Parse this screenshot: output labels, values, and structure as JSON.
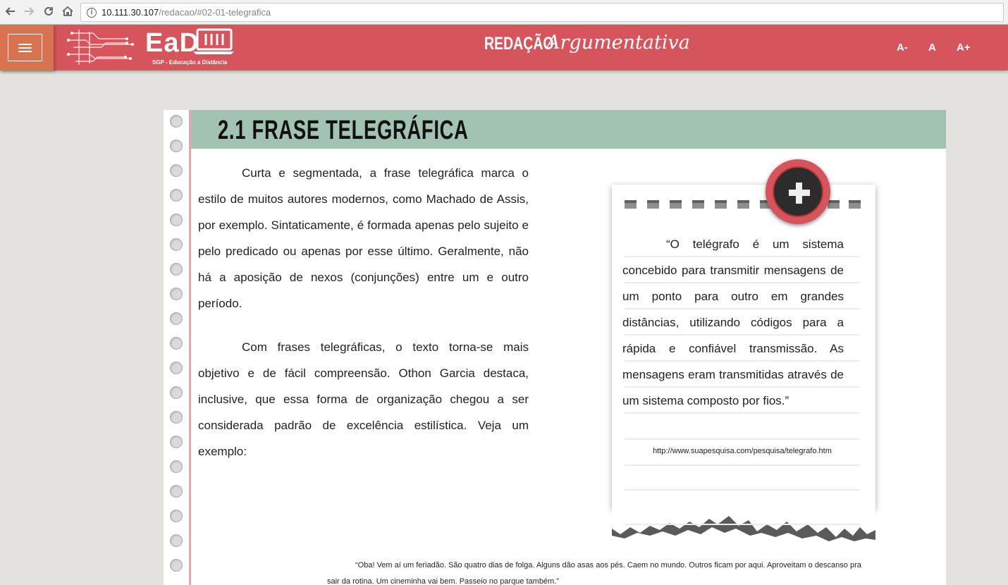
{
  "browser": {
    "url_host": "10.111.30.107",
    "url_path": "/redacao/#02-01-telegrafica"
  },
  "header": {
    "logo_text": "EaD",
    "logo_subtitle": "SGP - Educação a Distância",
    "title_part1": "REDAÇÃO",
    "title_part2": "Argumentativa",
    "font_smaller": "A-",
    "font_normal": "A",
    "font_larger": "A+"
  },
  "section": {
    "title": "2.1 FRASE TELEGRÁFICA"
  },
  "body": {
    "paragraph1": "Curta e segmentada, a frase telegráfica marca o estilo de muitos autores modernos, como Machado de Assis, por exemplo. Sintaticamente, é formada apenas pelo sujeito e pelo predicado ou apenas por esse último. Geralmente, não há a aposição de nexos (conjunções) entre um e outro período.",
    "paragraph2": "Com frases telegráficas, o texto torna-se mais objetivo e de fácil compreensão. Othon Garcia destaca, inclusive, que essa forma de organização chegou a ser considerada padrão de excelência estilística. Veja um exemplo:"
  },
  "note": {
    "quote": "“O telégrafo é um sistema concebido para transmitir mensagens de um ponto para outro em grandes distâncias, utilizando códigos para a rápida e confiável transmissão. As mensagens eram transmitidas através de um sistema composto por fios.”",
    "source": "http://www.suapesquisa.com/pesquisa/telegrafo.htm"
  },
  "example_quote": "“Oba! Vem aí um feriadão. São quatro dias de folga. Alguns dão asas aos pés. Caem no mundo. Outros ficam por aqui. Aproveitam o descanso pra sair da rotina. Um cineminha vai bem. Passeio no parque também.”",
  "colors": {
    "header": "#d6555c",
    "menu_button": "#d9724f",
    "title_band": "#a2c3b1",
    "background": "#e4e2df"
  }
}
